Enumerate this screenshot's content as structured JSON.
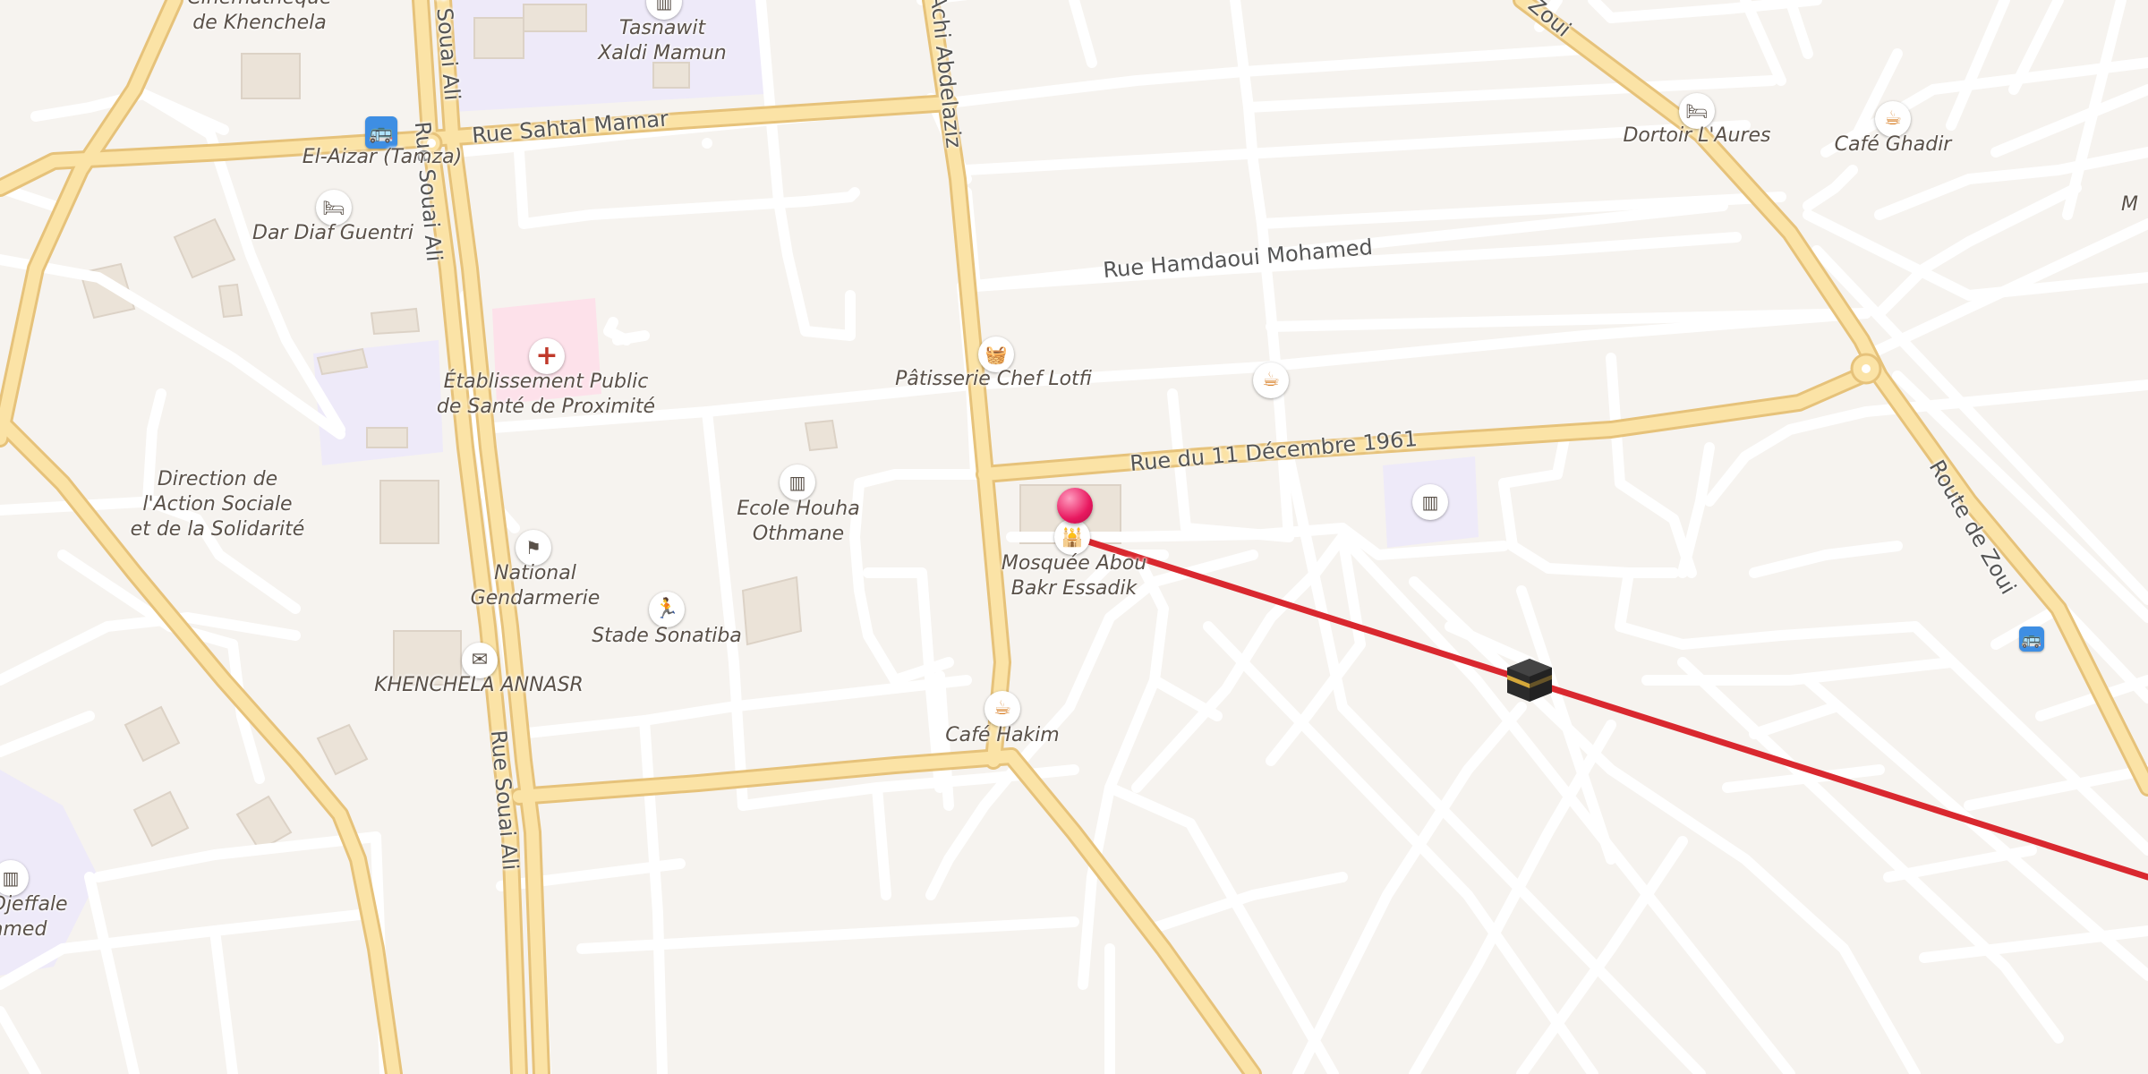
{
  "map": {
    "roads": {
      "rue_souai_ali": "Rue Souai Ali",
      "rue_sahtal_mamar": "Rue Sahtal Mamar",
      "rue_hamdaoui": "Rue Hamdaoui Mohamed",
      "rue_11_dec": "Rue du 11 Décembre 1961",
      "route_zoui": "Route de Zoui",
      "rue_achi": "Achi Abdelaziz",
      "zoui_top": "Zoui"
    },
    "places": {
      "cinematheque_line1": "Cinémathèque",
      "cinematheque_line2": "de Khenchela",
      "tasnawit_line1": "Tasnawit",
      "tasnawit_line2": "Xaldi Mamun",
      "el_aizar": "El-Aizar (Tamza)",
      "dar_diaf": "Dar Diaf Guentri",
      "etab_line1": "Établissement Public",
      "etab_line2": "de Santé de Proximité",
      "direction_line1": "Direction de",
      "direction_line2": "l'Action Sociale",
      "direction_line3": "et de la Solidarité",
      "gendarmerie_line1": "National",
      "gendarmerie_line2": "Gendarmerie",
      "stade": "Stade Sonatiba",
      "khenchela_annasr": "KHENCHELA ANNASR",
      "ecole_line1": "Ecole Houha",
      "ecole_line2": "Othmane",
      "patisserie": "Pâtisserie Chef Lotfi",
      "mosquee_line1": "Mosquée Abou",
      "mosquee_line2": "Bakr Essadik",
      "cafe_hakim": "Café Hakim",
      "dortoir": "Dortoir L'Aures",
      "cafe_ghadir": "Café Ghadir",
      "djeffale_line1": "Djeffale",
      "djeffale_line2": "amed",
      "edge_m": "M"
    },
    "colors": {
      "background": "#f6f3ef",
      "minor_road": "#ffffff",
      "major_road": "#fbe3a6",
      "major_road_casing": "#e6c27a",
      "building": "#ebe3d8",
      "education_area": "#eeeaf9",
      "hospital_area": "#fde1ea",
      "qibla_line": "#d9282f",
      "pin": "#e8185f",
      "cafe_icon": "#d9822b",
      "shop_icon": "#5567c9",
      "hospital_icon": "#c0392b",
      "sport_icon": "#4aa83a",
      "bus_stop": "#3e8ee3"
    },
    "icons": {
      "school": "school-icon",
      "hotel": "hotel-icon",
      "hospital": "hospital-icon",
      "police": "police-icon",
      "post": "envelope-icon",
      "sport": "running-icon",
      "shop": "basket-icon",
      "cafe": "coffee-cup-icon",
      "mosque": "mosque-icon",
      "bus": "bus-icon",
      "kaaba": "kaaba-icon",
      "pin": "location-pin-icon"
    }
  }
}
